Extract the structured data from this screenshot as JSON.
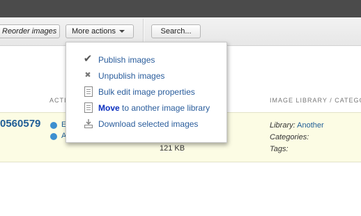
{
  "toolbar": {
    "reorder_label": "Reorder images",
    "more_actions_label": "More actions",
    "search_label": "Search..."
  },
  "menu": {
    "items": [
      {
        "icon": "checkmark-icon",
        "label": "Publish images"
      },
      {
        "icon": "x-icon",
        "label": "Unpublish images"
      },
      {
        "icon": "document-icon",
        "label": "Bulk edit image properties"
      },
      {
        "icon": "document-icon",
        "label_bold": "Move",
        "label_rest": " to another image library"
      },
      {
        "icon": "download-icon",
        "label": "Download selected images"
      }
    ]
  },
  "table": {
    "headers": {
      "actions": "ACTI",
      "library": "IMAGE LIBRARY / CATEGO"
    },
    "row": {
      "id": "0560579",
      "actions": [
        "E",
        "A"
      ],
      "file_size": "121 KB",
      "library_label": "Library:",
      "library_value": "Another",
      "categories_label": "Categories:",
      "tags_label": "Tags:"
    }
  }
}
